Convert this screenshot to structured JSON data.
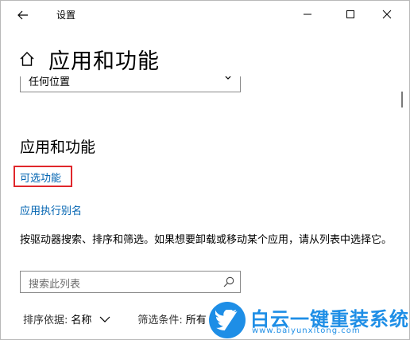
{
  "window": {
    "title": "设置"
  },
  "header": {
    "page_title": "应用和功能"
  },
  "dropdown": {
    "value": "任何位置"
  },
  "section": {
    "title": "应用和功能",
    "optional_features_link": "可选功能",
    "app_alias_link": "应用执行别名",
    "description": "按驱动器搜索、排序和筛选。如果想要卸载或移动某个应用，请从列表中选择它。"
  },
  "search": {
    "placeholder": "搜索此列表"
  },
  "sort": {
    "label": "排序依据:",
    "value": "名称"
  },
  "filter": {
    "label": "筛选条件:",
    "value": "所有"
  },
  "watermark": {
    "text": "白云一键重装系统",
    "url": "www.baiyunxitong.com"
  },
  "colors": {
    "link": "#0063b1",
    "highlight": "#e0272b",
    "watermark": "#1e8ee6"
  },
  "icons": {
    "back": "back-arrow-icon",
    "home": "home-icon",
    "minimize": "minimize-icon",
    "maximize": "maximize-icon",
    "close": "close-icon",
    "dropdown": "chevron-down-icon",
    "search": "search-icon",
    "logo": "bird-logo-icon"
  }
}
